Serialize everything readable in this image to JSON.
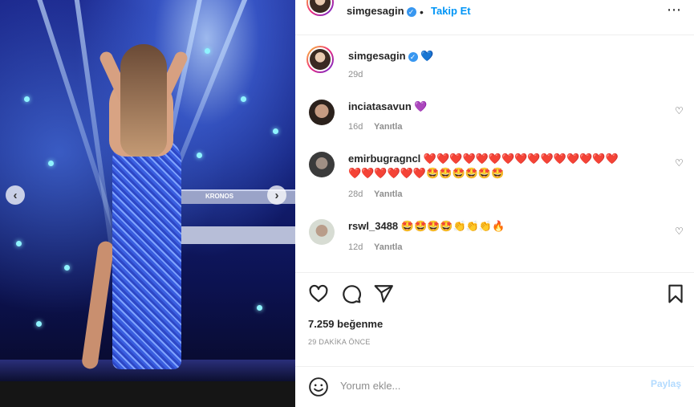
{
  "post": {
    "author": "simgesagin",
    "follow_separator": "•",
    "follow_label": "Takip Et",
    "more_icon": "⋯",
    "caption_emoji": "💙",
    "caption_age": "29d"
  },
  "comments": [
    {
      "username": "inciatasavun",
      "text": "💜",
      "age": "16d",
      "reply_label": "Yanıtla"
    },
    {
      "username": "emirbugragncl",
      "text": "❤️❤️❤️❤️❤️❤️❤️❤️❤️❤️❤️❤️❤️❤️❤️",
      "text2": "❤️❤️❤️❤️❤️❤️🤩🤩🤩🤩🤩🤩",
      "age": "28d",
      "reply_label": "Yanıtla"
    },
    {
      "username": "rswl_3488",
      "text": "🤩🤩🤩🤩👏👏👏🔥",
      "age": "12d",
      "reply_label": "Yanıtla"
    }
  ],
  "actions": {
    "like_icon": "heart-outline",
    "comment_icon": "comment-bubble",
    "share_icon": "paper-plane",
    "save_icon": "bookmark"
  },
  "stats": {
    "likes": "7.259 beğenme",
    "time_ago": "29 DAKİKA ÖNCE"
  },
  "comment_box": {
    "placeholder": "Yorum ekle...",
    "post_label": "Paylaş"
  },
  "photo": {
    "prev_icon": "‹",
    "next_icon": "›",
    "keyboard_brand": "KRONOS"
  },
  "colors": {
    "link_blue": "#0095f6",
    "post_disabled": "#b3dbff",
    "text_dark": "#262626",
    "text_muted": "#8e8e8e"
  }
}
